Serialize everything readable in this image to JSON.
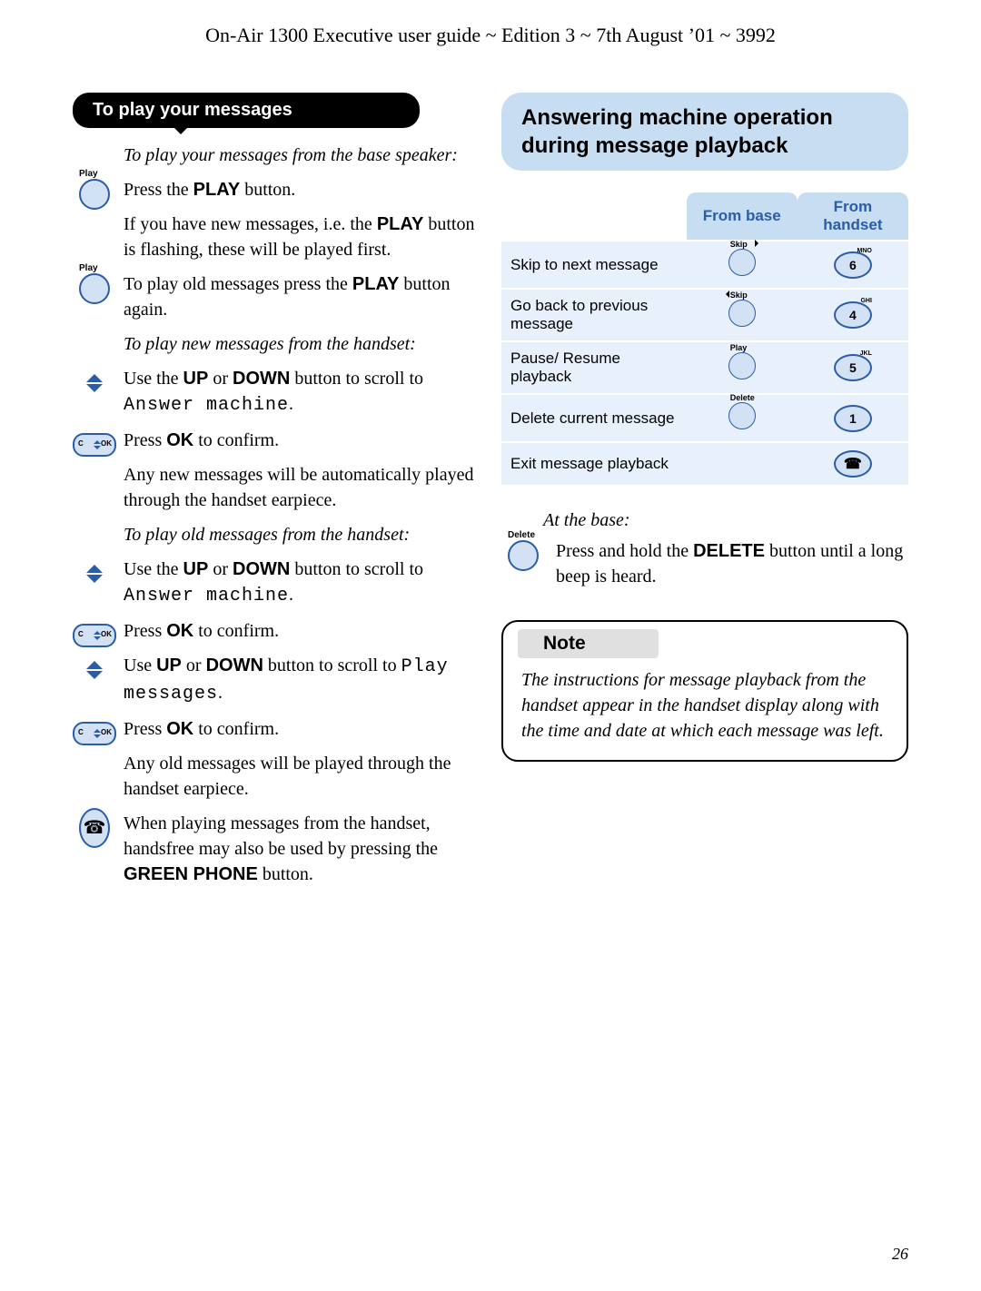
{
  "header": "On-Air 1300 Executive user guide ~ Edition 3 ~ 7th August ’01 ~ 3992",
  "page_number": "26",
  "left": {
    "tab": "To play your messages",
    "h1": "To play your messages from the base speaker:",
    "p1a": "Press the ",
    "p1b": "PLAY",
    "p1c": " button.",
    "p2a": "If you have new messages, i.e. the ",
    "p2b": "PLAY",
    "p2c": " button is flashing, these will be played first.",
    "p3a": "To play old messages press the ",
    "p3b": "PLAY",
    "p3c": " button again.",
    "h2": "To play new messages from the handset:",
    "p4a": "Use the ",
    "p4b": "UP",
    "p4c": " or ",
    "p4d": "DOWN",
    "p4e": " button to scroll to ",
    "p4f": "Answer machine",
    "p4g": ".",
    "p5a": "Press ",
    "p5b": "OK",
    "p5c": " to confirm.",
    "p6": "Any new messages will be automatically played through the handset earpiece.",
    "h3": "To play old messages from the handset:",
    "p7a": "Use the ",
    "p7b": "UP",
    "p7c": " or ",
    "p7d": "DOWN",
    "p7e": " button to scroll to ",
    "p7f": "Answer machine",
    "p7g": ".",
    "p8a": "Press ",
    "p8b": "OK",
    "p8c": " to confirm.",
    "p9a": "Use ",
    "p9b": "UP",
    "p9c": " or ",
    "p9d": "DOWN",
    "p9e": " button to scroll to ",
    "p9f": "Play messages",
    "p9g": ".",
    "p10a": "Press ",
    "p10b": "OK",
    "p10c": " to confirm.",
    "p11": "Any old messages will be played through the handset earpiece.",
    "p12a": "When playing messages from the handset, handsfree may also be used by pressing the ",
    "p12b": "GREEN PHONE",
    "p12c": " button.",
    "icon_play_label": "Play",
    "icon_delete_label": "Delete"
  },
  "right": {
    "heading": "Answering machine operation during message playback",
    "th_base": "From base",
    "th_hand": "From handset",
    "rows": [
      {
        "label": "Skip to next message",
        "base": "Skip",
        "hand": "6",
        "sup": "MNO"
      },
      {
        "label": "Go back to previous message",
        "base": "Skip",
        "hand": "4",
        "sup": "GHI"
      },
      {
        "label": "Pause/ Resume playback",
        "base": "Play",
        "hand": "5",
        "sup": "JKL"
      },
      {
        "label": "Delete current message",
        "base": "Delete",
        "hand": "1",
        "sup": ""
      },
      {
        "label": "Exit message playback",
        "base": "",
        "hand": "☎",
        "sup": ""
      }
    ],
    "sub_head": "At the base:",
    "sub_a": "Press and hold the ",
    "sub_b": "DELETE",
    "sub_c": " button until a long beep is heard.",
    "note_head": "Note",
    "note_body": "The instructions for message playback from the handset appear in the handset display along with the time and date at which each message was left."
  }
}
